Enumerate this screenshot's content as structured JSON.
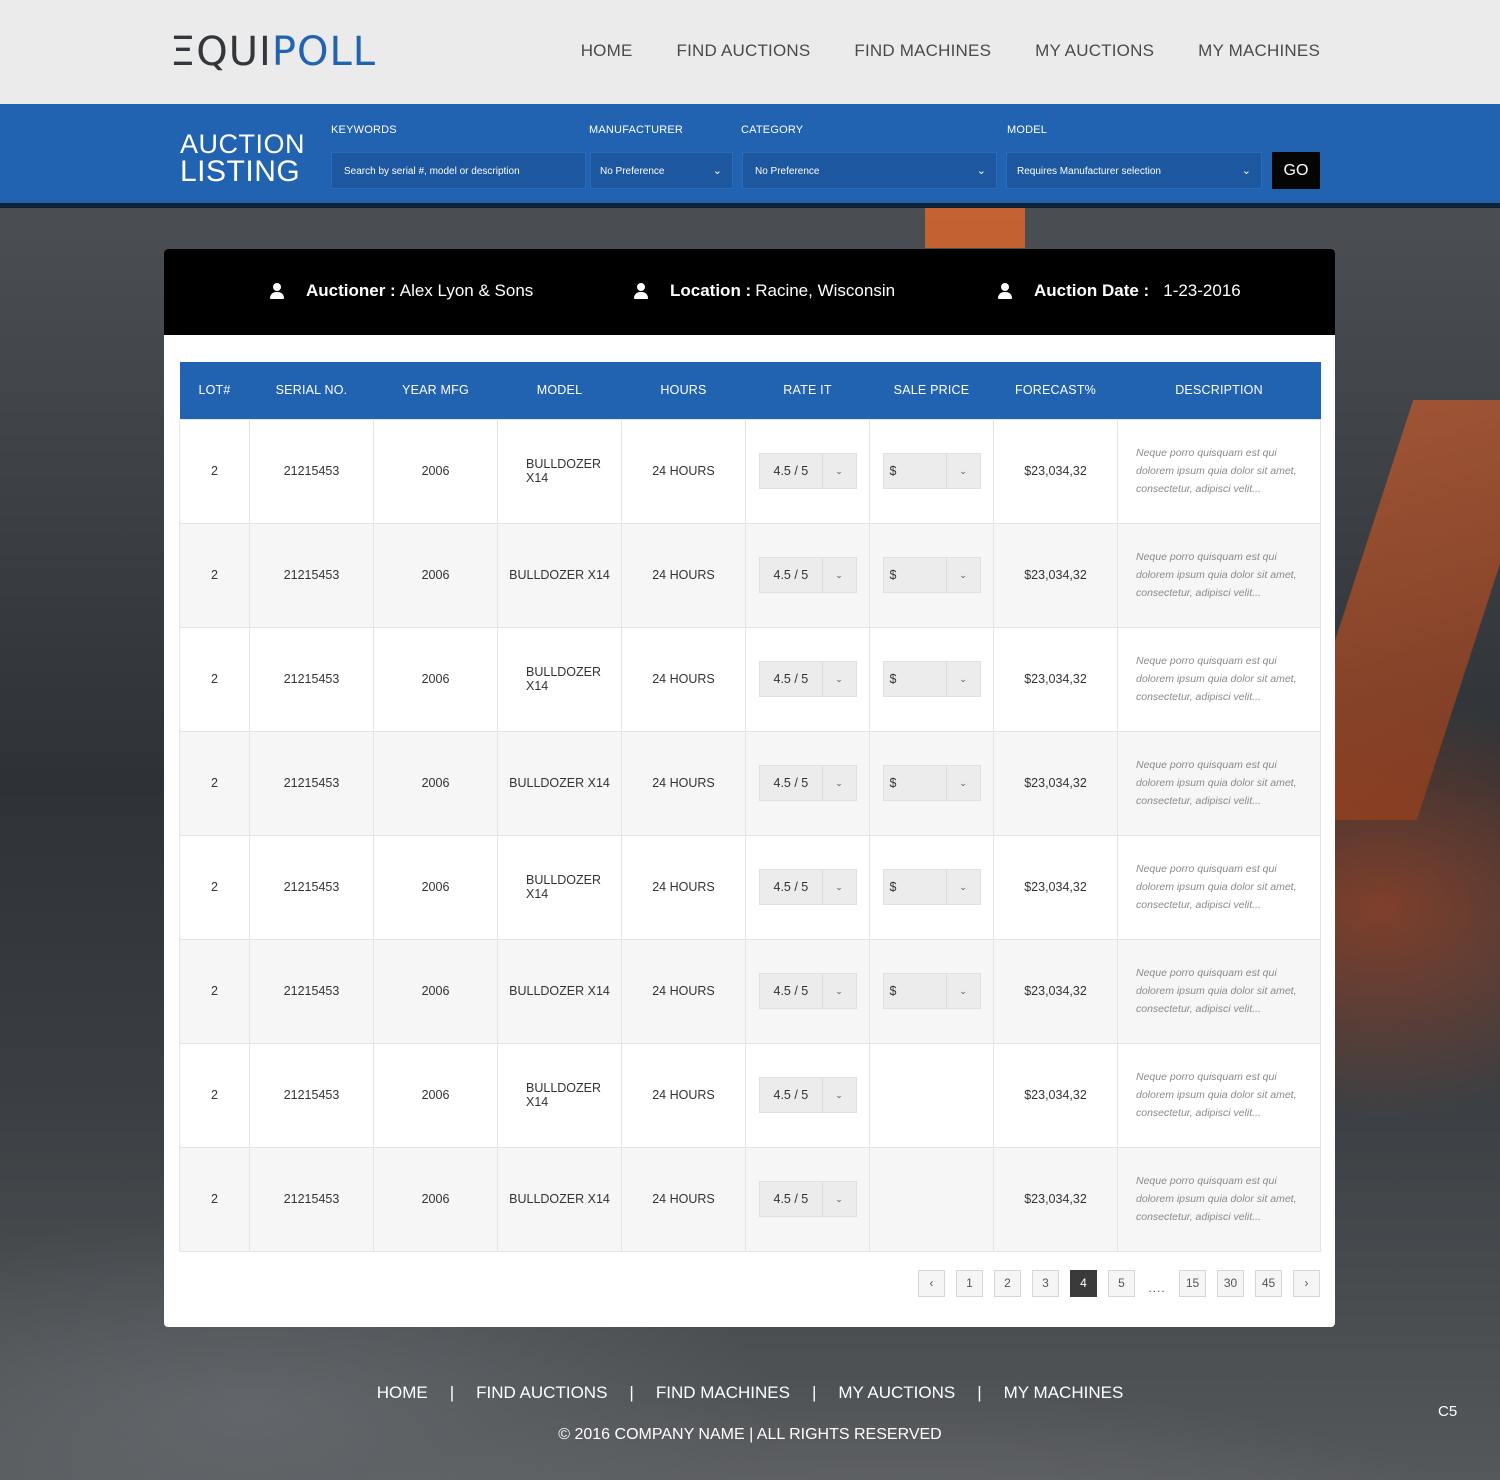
{
  "logo": {
    "part1": "ΞQUI",
    "part2": "POLL"
  },
  "nav": [
    "HOME",
    "FIND AUCTIONS",
    "FIND MACHINES",
    "MY AUCTIONS",
    "MY MACHINES"
  ],
  "search": {
    "heading_line1": "AUCTION",
    "heading_line2": "LISTING",
    "keywords_label": "KEYWORDS",
    "keywords_placeholder": "Search by serial #, model or description",
    "manufacturer_label": "MANUFACTURER",
    "manufacturer_value": "No Preference",
    "category_label": "CATEGORY",
    "category_value": "No Preference",
    "model_label": "MODEL",
    "model_value": "Requires Manufacturer selection",
    "go_label": "GO"
  },
  "auction_info": {
    "auctioneer_label": "Auctioner :",
    "auctioneer_value": "Alex Lyon & Sons",
    "location_label": "Location :",
    "location_value": "Racine, Wisconsin",
    "date_label": "Auction Date :",
    "date_value": "1-23-2016"
  },
  "table": {
    "columns": [
      "LOT#",
      "SERIAL NO.",
      "YEAR MFG",
      "MODEL",
      "HOURS",
      "RATE IT",
      "SALE PRICE",
      "FORECAST%",
      "DESCRIPTION"
    ],
    "rows": [
      {
        "lot": "2",
        "serial": "21215453",
        "year": "2006",
        "model": "BULLDOZER X14",
        "hours": "24 HOURS",
        "rate": "4.5 / 5",
        "price": "$",
        "forecast": "$23,034,32",
        "desc": "Neque porro quisquam est qui dolorem ipsum quia dolor sit amet, consectetur, adipisci velit..."
      },
      {
        "lot": "2",
        "serial": "21215453",
        "year": "2006",
        "model": "BULLDOZER X14",
        "hours": "24 HOURS",
        "rate": "4.5 / 5",
        "price": "$",
        "forecast": "$23,034,32",
        "desc": "Neque porro quisquam est qui dolorem ipsum quia dolor sit amet, consectetur, adipisci velit..."
      },
      {
        "lot": "2",
        "serial": "21215453",
        "year": "2006",
        "model": "BULLDOZER X14",
        "hours": "24 HOURS",
        "rate": "4.5 / 5",
        "price": "$",
        "forecast": "$23,034,32",
        "desc": "Neque porro quisquam est qui dolorem ipsum quia dolor sit amet, consectetur, adipisci velit..."
      },
      {
        "lot": "2",
        "serial": "21215453",
        "year": "2006",
        "model": "BULLDOZER X14",
        "hours": "24 HOURS",
        "rate": "4.5 / 5",
        "price": "$",
        "forecast": "$23,034,32",
        "desc": "Neque porro quisquam est qui dolorem ipsum quia dolor sit amet, consectetur, adipisci velit..."
      },
      {
        "lot": "2",
        "serial": "21215453",
        "year": "2006",
        "model": "BULLDOZER X14",
        "hours": "24 HOURS",
        "rate": "4.5 / 5",
        "price": "$",
        "forecast": "$23,034,32",
        "desc": "Neque porro quisquam est qui dolorem ipsum quia dolor sit amet, consectetur, adipisci velit..."
      },
      {
        "lot": "2",
        "serial": "21215453",
        "year": "2006",
        "model": "BULLDOZER X14",
        "hours": "24 HOURS",
        "rate": "4.5 / 5",
        "price": "$",
        "forecast": "$23,034,32",
        "desc": "Neque porro quisquam est qui dolorem ipsum quia dolor sit amet, consectetur, adipisci velit..."
      },
      {
        "lot": "2",
        "serial": "21215453",
        "year": "2006",
        "model": "BULLDOZER X14",
        "hours": "24 HOURS",
        "rate": "4.5 / 5",
        "price": "",
        "forecast": "$23,034,32",
        "desc": "Neque porro quisquam est qui dolorem ipsum quia dolor sit amet, consectetur, adipisci velit..."
      },
      {
        "lot": "2",
        "serial": "21215453",
        "year": "2006",
        "model": "BULLDOZER X14",
        "hours": "24 HOURS",
        "rate": "4.5 / 5",
        "price": "",
        "forecast": "$23,034,32",
        "desc": "Neque porro quisquam est qui dolorem ipsum quia dolor sit amet, consectetur, adipisci velit..."
      }
    ]
  },
  "pagination": {
    "prev_icon": "chevron-left-icon",
    "pages": [
      "1",
      "2",
      "3",
      "4",
      "5",
      "....",
      "15",
      "30",
      "45"
    ],
    "active": "4",
    "next_icon": "chevron-right-icon"
  },
  "footer": {
    "nav": [
      "HOME",
      "FIND AUCTIONS",
      "FIND MACHINES",
      "MY AUCTIONS",
      "MY MACHINES"
    ],
    "separator": "|",
    "copyright": "© 2016 COMPANY NAME  | ALL RIGHTS RESERVED",
    "corner": "C5"
  },
  "colors": {
    "brand_blue": "#2263b1",
    "header_bg": "#ebebeb",
    "info_bar": "#000000"
  }
}
